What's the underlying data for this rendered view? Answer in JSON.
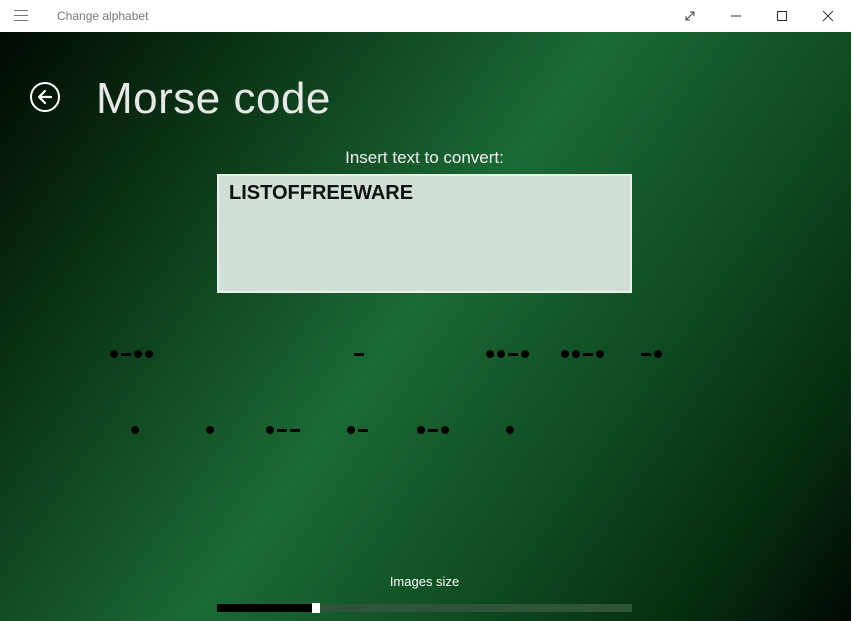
{
  "window": {
    "title": "Change alphabet",
    "menu_icon": "hamburger-icon",
    "buttons": [
      "expand-icon",
      "minimize-icon",
      "maximize-icon",
      "close-icon"
    ]
  },
  "page": {
    "title": "Morse code",
    "back_icon": "back-arrow-icon"
  },
  "input": {
    "label": "Insert text to convert:",
    "value": "LISTOFFREEWARE"
  },
  "morse_rows": [
    [
      "·–··",
      "–",
      "··–·",
      "··–·",
      "–·"
    ],
    [
      "·",
      "·",
      "·––",
      "·–",
      "·–·",
      "·"
    ]
  ],
  "slider": {
    "label": "Images size",
    "value_fraction": 0.23
  },
  "colors": {
    "background_green": "#1b6a35",
    "input_bg": "#d1dfd6"
  }
}
